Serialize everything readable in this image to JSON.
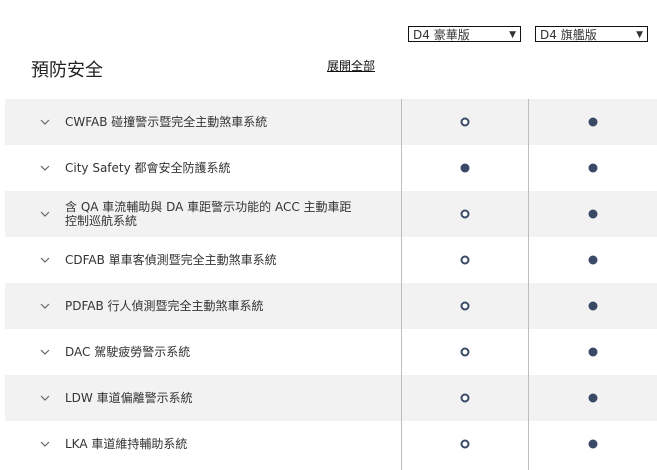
{
  "header": {
    "title": "預防安全",
    "expand_all": "展開全部"
  },
  "trims": [
    {
      "label": "D4 豪華版",
      "arrow": "▼"
    },
    {
      "label": "D4 旗艦版",
      "arrow": "▼"
    }
  ],
  "rows": [
    {
      "label": "CWFAB 碰撞警示暨完全主動煞車系統",
      "values": [
        "hollow",
        "filled"
      ]
    },
    {
      "label": "City Safety 都會安全防護系統",
      "values": [
        "filled",
        "filled"
      ]
    },
    {
      "label": "含 QA 車流輔助與 DA 車距警示功能的 ACC 主動車距控制巡航系統",
      "values": [
        "hollow",
        "filled"
      ]
    },
    {
      "label": "CDFAB 單車客偵測暨完全主動煞車系統",
      "values": [
        "hollow",
        "filled"
      ]
    },
    {
      "label": "PDFAB 行人偵測暨完全主動煞車系統",
      "values": [
        "hollow",
        "filled"
      ]
    },
    {
      "label": "DAC 駕駛疲勞警示系統",
      "values": [
        "hollow",
        "filled"
      ]
    },
    {
      "label": "LDW 車道偏離警示系統",
      "values": [
        "hollow",
        "filled"
      ]
    },
    {
      "label": "LKA 車道維持輔助系統",
      "values": [
        "hollow",
        "filled"
      ]
    }
  ],
  "colors": {
    "accent": "#3a4a66",
    "row_shade": "#f2f2f2",
    "divider": "#bdbdbd"
  }
}
